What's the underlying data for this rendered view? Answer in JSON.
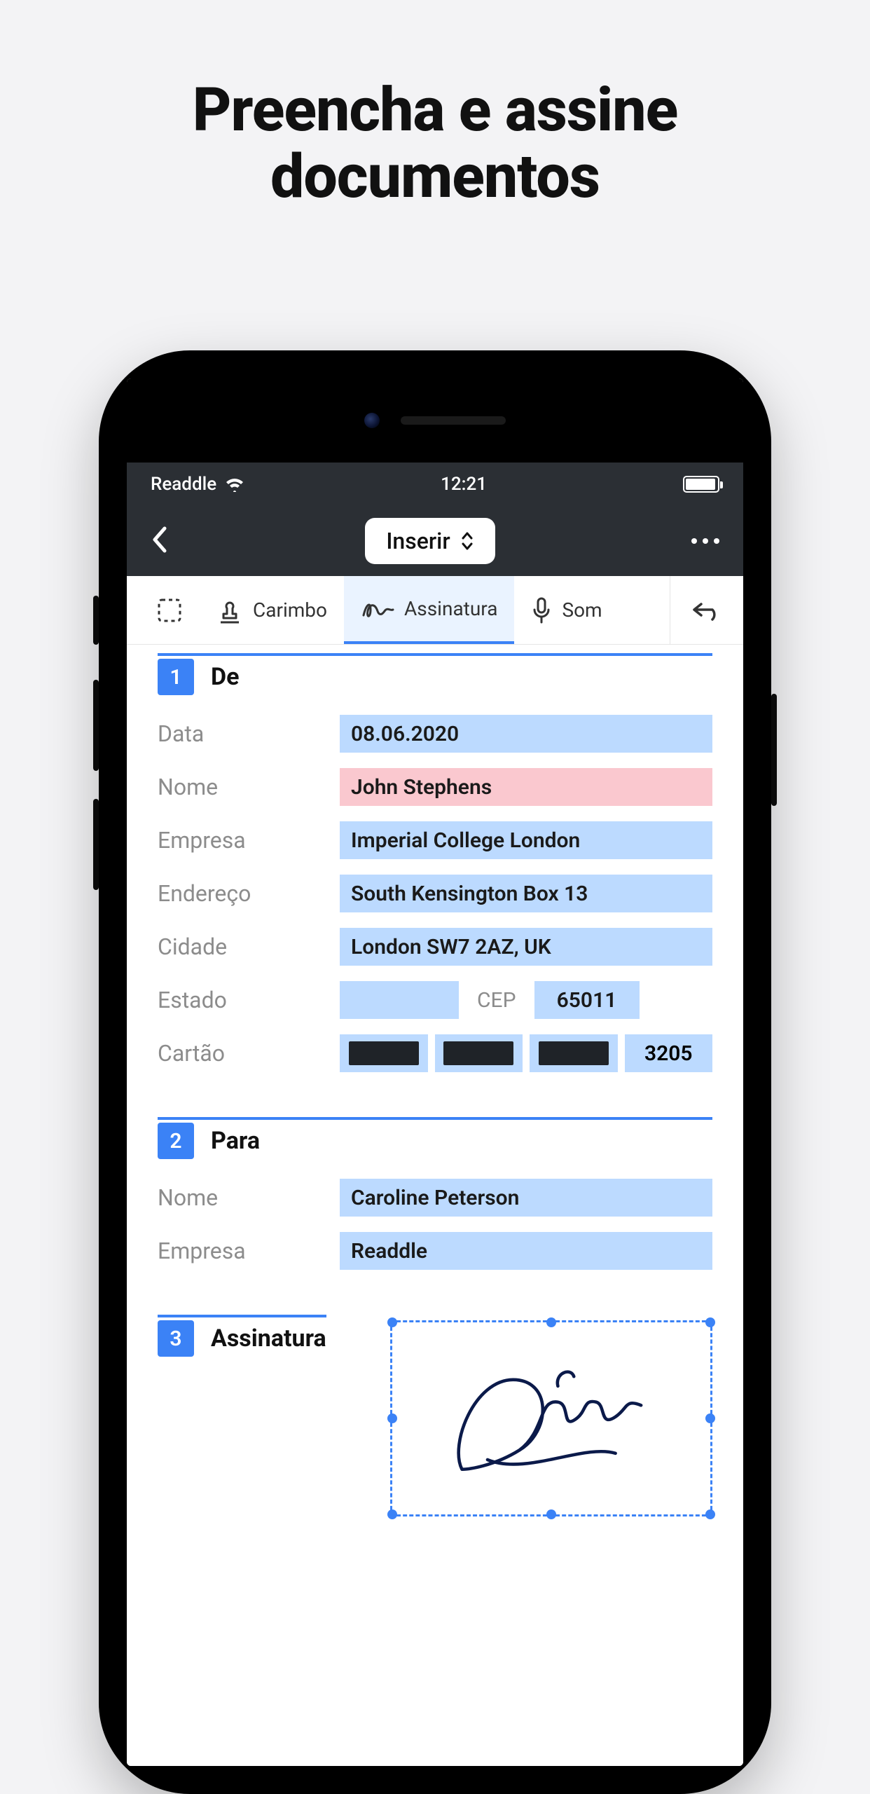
{
  "hero": {
    "line1": "Preencha e assine",
    "line2": "documentos"
  },
  "statusbar": {
    "carrier": "Readdle",
    "time": "12:21"
  },
  "navbar": {
    "mode_label": "Inserir"
  },
  "toolbar": {
    "stamp": "Carimbo",
    "signature": "Assinatura",
    "sound": "Som"
  },
  "sections": {
    "s1": {
      "num": "1",
      "title": "De"
    },
    "s2": {
      "num": "2",
      "title": "Para"
    },
    "s3": {
      "num": "3",
      "title": "Assinatura"
    }
  },
  "labels": {
    "data": "Data",
    "nome": "Nome",
    "empresa": "Empresa",
    "endereco": "Endereço",
    "cidade": "Cidade",
    "estado": "Estado",
    "cep": "CEP",
    "cartao": "Cartão"
  },
  "from": {
    "data": "08.06.2020",
    "nome": "John Stephens",
    "empresa": "Imperial College London",
    "endereco": "South Kensington Box 13",
    "cidade": "London SW7 2AZ, UK",
    "estado": "",
    "cep": "65011",
    "cartao_last4": "3205"
  },
  "to": {
    "nome": "Caroline Peterson",
    "empresa": "Readdle"
  }
}
